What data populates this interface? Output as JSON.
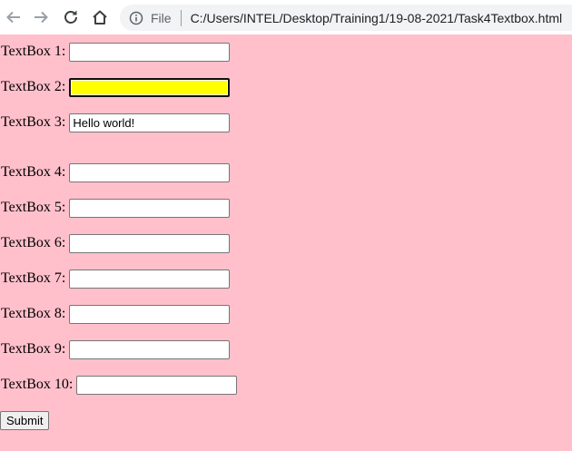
{
  "browser": {
    "scheme_label": "File",
    "url": "C:/Users/INTEL/Desktop/Training1/19-08-2021/Task4Textbox.html"
  },
  "form": {
    "fields": [
      {
        "label": "TextBox 1:",
        "value": ""
      },
      {
        "label": "TextBox 2:",
        "value": ""
      },
      {
        "label": "TextBox 3:",
        "value": "Hello world!"
      },
      {
        "label": "TextBox 4:",
        "value": ""
      },
      {
        "label": "TextBox 5:",
        "value": ""
      },
      {
        "label": "TextBox 6:",
        "value": ""
      },
      {
        "label": "TextBox 7:",
        "value": ""
      },
      {
        "label": "TextBox 8:",
        "value": ""
      },
      {
        "label": "TextBox 9:",
        "value": ""
      },
      {
        "label": "TextBox 10:",
        "value": ""
      }
    ],
    "submit_label": "Submit"
  },
  "colors": {
    "page_background": "#ffc0cb",
    "focused_field_background": "#ffff00"
  }
}
